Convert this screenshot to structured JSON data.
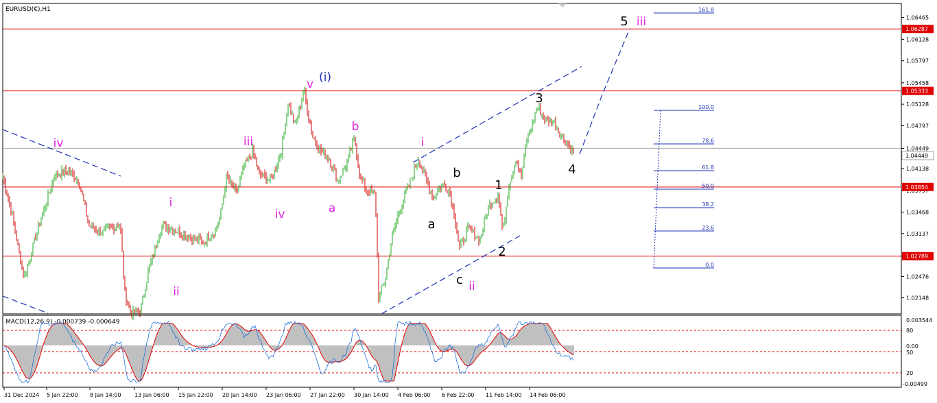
{
  "chart_data": [
    {
      "type": "candlestick",
      "title": "EURUSD(€),H1",
      "symbol": "EURUSD(€)",
      "timeframe": "H1",
      "ylim": [
        1.019,
        1.0668
      ],
      "price_ticks": [
        "1.06465",
        "1.06128",
        "1.05797",
        "1.05458",
        "1.05128",
        "1.04797",
        "1.04449",
        "1.04138",
        "1.03797",
        "1.03468",
        "1.03137",
        "1.02789",
        "1.02476",
        "1.02148"
      ],
      "x_labels": [
        "31 Dec 2024",
        "5 Jan 22:00",
        "8 Jan 14:00",
        "13 Jan 06:00",
        "15 Jan 22:00",
        "20 Jan 14:00",
        "23 Jan 06:00",
        "27 Jan 22:00",
        "30 Jan 14:00",
        "4 Feb 06:00",
        "6 Feb 22:00",
        "11 Feb 14:00",
        "14 Feb 06:00"
      ],
      "horizontal_levels": [
        {
          "label": "1.06287",
          "value": 1.06287
        },
        {
          "label": "1.05333",
          "value": 1.05333
        },
        {
          "label": "1.03854",
          "value": 1.03854
        },
        {
          "label": "1.02789",
          "value": 1.02789
        }
      ],
      "current_price": {
        "label": "1.04449",
        "value": 1.04449
      },
      "fibonacci": [
        "161.8",
        "100.0",
        "78.6",
        "61.8",
        "50.0",
        "38.2",
        "23.6",
        "0.0"
      ],
      "price_anchors": [
        [
          0,
          1.042
        ],
        [
          15,
          1.0355
        ],
        [
          35,
          1.0245
        ],
        [
          55,
          1.032
        ],
        [
          80,
          1.0405
        ],
        [
          100,
          1.041
        ],
        [
          115,
          1.0395
        ],
        [
          130,
          1.0325
        ],
        [
          150,
          1.0315
        ],
        [
          175,
          1.033
        ],
        [
          182,
          1.022
        ],
        [
          192,
          1.019
        ],
        [
          205,
          1.0195
        ],
        [
          215,
          1.025
        ],
        [
          235,
          1.0325
        ],
        [
          255,
          1.032
        ],
        [
          275,
          1.031
        ],
        [
          295,
          1.03
        ],
        [
          315,
          1.032
        ],
        [
          322,
          1.0345
        ],
        [
          330,
          1.04
        ],
        [
          345,
          1.0375
        ],
        [
          355,
          1.0415
        ],
        [
          368,
          1.044
        ],
        [
          378,
          1.0405
        ],
        [
          395,
          1.0395
        ],
        [
          410,
          1.044
        ],
        [
          420,
          1.0515
        ],
        [
          430,
          1.048
        ],
        [
          443,
          1.0535
        ],
        [
          455,
          1.0465
        ],
        [
          468,
          1.044
        ],
        [
          480,
          1.043
        ],
        [
          492,
          1.0395
        ],
        [
          505,
          1.042
        ],
        [
          517,
          1.046
        ],
        [
          525,
          1.04
        ],
        [
          535,
          1.038
        ],
        [
          547,
          1.0375
        ],
        [
          552,
          1.0215
        ],
        [
          562,
          1.0245
        ],
        [
          570,
          1.03
        ],
        [
          582,
          1.035
        ],
        [
          595,
          1.0385
        ],
        [
          610,
          1.043
        ],
        [
          620,
          1.04
        ],
        [
          632,
          1.037
        ],
        [
          645,
          1.039
        ],
        [
          655,
          1.038
        ],
        [
          662,
          1.0345
        ],
        [
          670,
          1.029
        ],
        [
          682,
          1.032
        ],
        [
          700,
          1.0305
        ],
        [
          712,
          1.0355
        ],
        [
          726,
          1.0375
        ],
        [
          733,
          1.0315
        ],
        [
          742,
          1.039
        ],
        [
          752,
          1.043
        ],
        [
          760,
          1.04
        ],
        [
          768,
          1.046
        ],
        [
          776,
          1.048
        ],
        [
          783,
          1.051
        ],
        [
          795,
          1.049
        ],
        [
          808,
          1.0485
        ],
        [
          818,
          1.0465
        ],
        [
          826,
          1.0455
        ],
        [
          834,
          1.044
        ]
      ]
    },
    {
      "type": "line",
      "title": "MACD(12,26,9) -0.000739 -0.000649",
      "indicator": "MACD",
      "params": "12,26,9",
      "values": [
        "-0.000739",
        "-0.000649"
      ],
      "ylim": [
        -0.00499,
        0.003544
      ],
      "tick_labels": [
        "0.003544",
        "80",
        "0.00",
        "50",
        "20",
        "-0.00499"
      ],
      "colors": {
        "histogram": "#c0c0c0",
        "main": "#1e6fd9",
        "signal": "#e00000"
      }
    }
  ],
  "wave_labels": [
    {
      "text": "iv",
      "color": "#e020e0"
    },
    {
      "text": "iii",
      "color": "#e020e0"
    },
    {
      "text": "v",
      "color": "#e020e0"
    },
    {
      "text": "(i)",
      "color": "#1a2fb5"
    },
    {
      "text": "b",
      "color": "#e020e0"
    },
    {
      "text": "i",
      "color": "#e020e0"
    },
    {
      "text": "i",
      "color": "#e020e0"
    },
    {
      "text": "ii",
      "color": "#e020e0"
    },
    {
      "text": "iv",
      "color": "#e020e0"
    },
    {
      "text": "a",
      "color": "#e020e0"
    },
    {
      "text": "ii",
      "color": "#e020e0"
    },
    {
      "text": "iii",
      "color": "#e020e0"
    },
    {
      "text": "5",
      "color": "#000000"
    },
    {
      "text": "3",
      "color": "#000000"
    },
    {
      "text": "b",
      "color": "#000000"
    },
    {
      "text": "1",
      "color": "#000000"
    },
    {
      "text": "a",
      "color": "#000000"
    },
    {
      "text": "2",
      "color": "#000000"
    },
    {
      "text": "c",
      "color": "#000000"
    },
    {
      "text": "4",
      "color": "#000000"
    }
  ],
  "colors": {
    "level_line": "#e00000",
    "level_tag": "#e00000",
    "bull": "#22a822",
    "bear": "#d00000",
    "trend": "#1a2fb5",
    "fib": "#1a2fb5"
  }
}
